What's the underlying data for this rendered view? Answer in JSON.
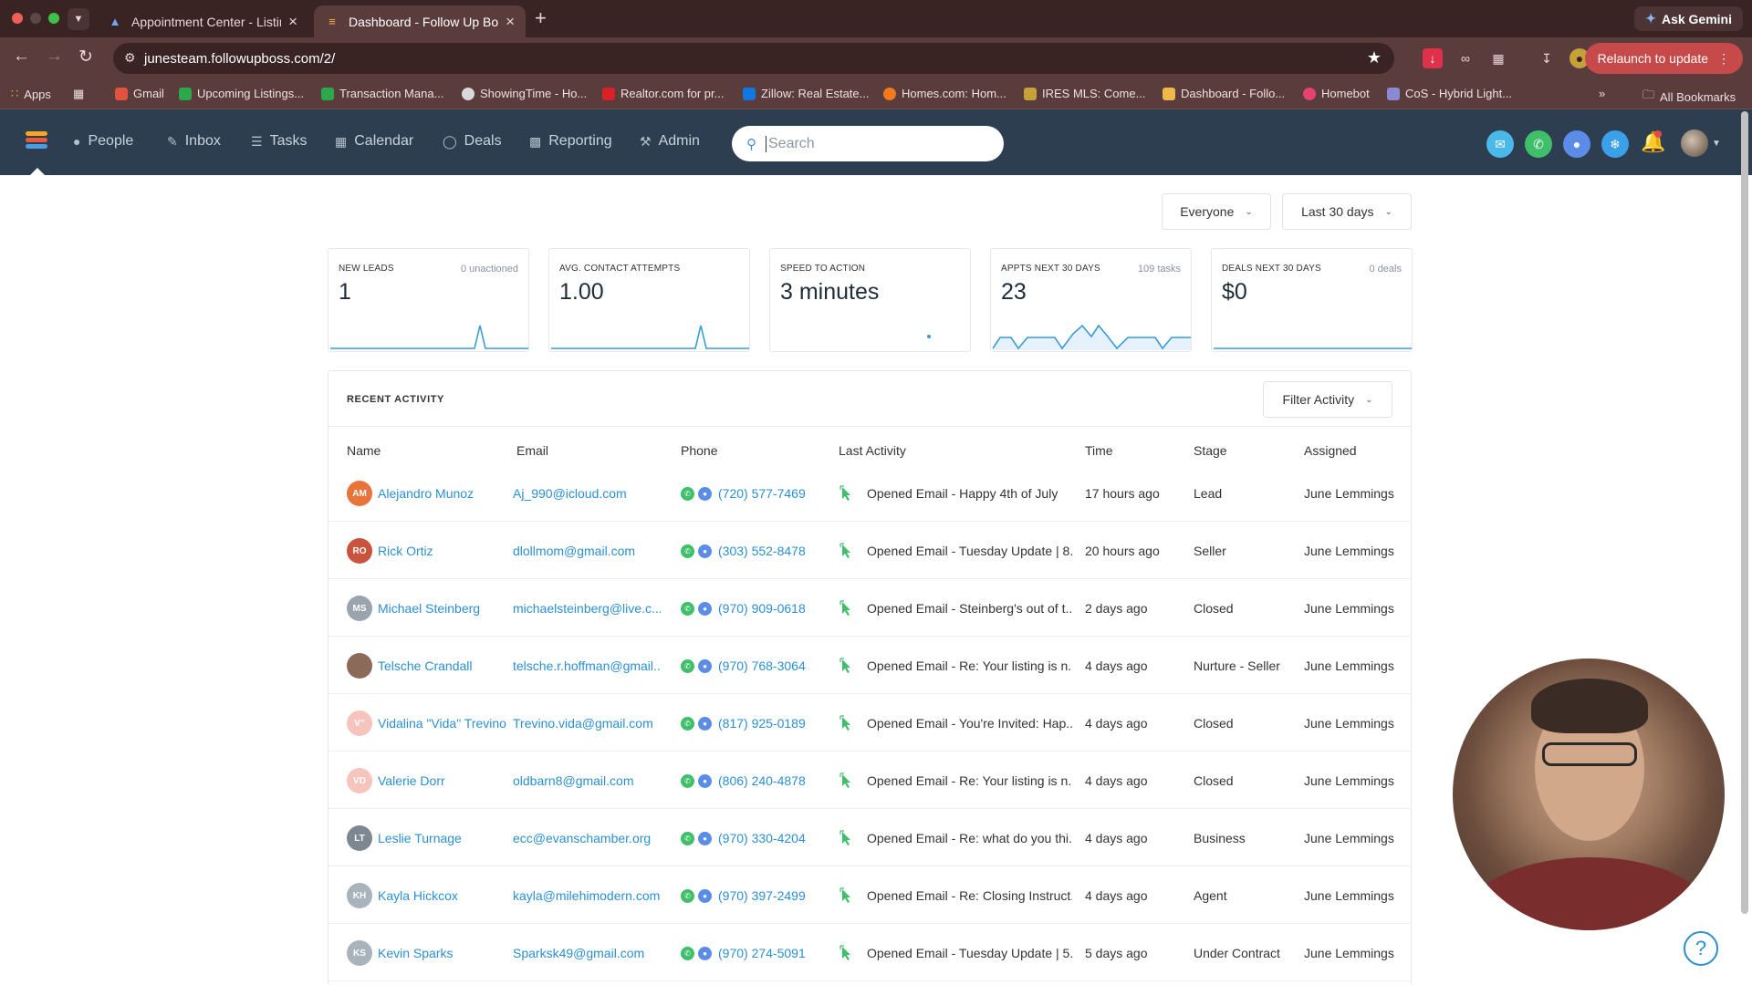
{
  "browser": {
    "tabs": [
      {
        "title": "Appointment Center - Listing",
        "active": false
      },
      {
        "title": "Dashboard - Follow Up Boss",
        "active": true
      }
    ],
    "url": "junesteam.followupboss.com/2/",
    "ask_gemini": "Ask Gemini",
    "relaunch": "Relaunch to update",
    "bookmarks": [
      "Apps",
      "Gmail",
      "Upcoming Listings...",
      "Transaction Mana...",
      "ShowingTime - Ho...",
      "Realtor.com for pr...",
      "Zillow: Real Estate...",
      "Homes.com: Hom...",
      "IRES MLS: Come...",
      "Dashboard - Follo...",
      "Homebot",
      "CoS - Hybrid Light..."
    ],
    "all_bookmarks": "All Bookmarks"
  },
  "nav": {
    "items": [
      "People",
      "Inbox",
      "Tasks",
      "Calendar",
      "Deals",
      "Reporting",
      "Admin"
    ],
    "search_placeholder": "Search"
  },
  "filters": {
    "who": "Everyone",
    "range": "Last 30 days"
  },
  "cards": [
    {
      "label": "NEW LEADS",
      "meta": "0 unactioned",
      "value": "1"
    },
    {
      "label": "AVG. CONTACT ATTEMPTS",
      "meta": "",
      "value": "1.00"
    },
    {
      "label": "SPEED TO ACTION",
      "meta": "",
      "value": "3 minutes"
    },
    {
      "label": "APPTS NEXT 30 DAYS",
      "meta": "109 tasks",
      "value": "23"
    },
    {
      "label": "DEALS NEXT 30 DAYS",
      "meta": "0 deals",
      "value": "$0"
    }
  ],
  "activity": {
    "title": "RECENT ACTIVITY",
    "filter_label": "Filter Activity",
    "columns": [
      "Name",
      "Email",
      "Phone",
      "Last Activity",
      "Time",
      "Stage",
      "Assigned"
    ],
    "rows": [
      {
        "initials": "AM",
        "color": "#e8743b",
        "name": "Alejandro Munoz",
        "email": "Aj_990@icloud.com",
        "phone": "(720) 577-7469",
        "activity": "Opened Email - Happy 4th of July",
        "time": "17 hours ago",
        "stage": "Lead",
        "assigned": "June Lemmings"
      },
      {
        "initials": "RO",
        "color": "#c9533d",
        "name": "Rick Ortiz",
        "email": "dlollmom@gmail.com",
        "phone": "(303) 552-8478",
        "activity": "Opened Email - Tuesday Update | 8...",
        "time": "20 hours ago",
        "stage": "Seller",
        "assigned": "June Lemmings"
      },
      {
        "initials": "MS",
        "color": "#9aa4ae",
        "name": "Michael Steinberg",
        "email": "michaelsteinberg@live.c...",
        "phone": "(970) 909-0618",
        "activity": "Opened Email - Steinberg's out of t...",
        "time": "2 days ago",
        "stage": "Closed",
        "assigned": "June Lemmings"
      },
      {
        "initials": "",
        "color": "#8b6a5a",
        "name": "Telsche Crandall",
        "email": "telsche.r.hoffman@gmail....",
        "phone": "(970) 768-3064",
        "activity": "Opened Email - Re: Your listing is n...",
        "time": "4 days ago",
        "stage": "Nurture - Seller",
        "assigned": "June Lemmings"
      },
      {
        "initials": "V\"",
        "color": "#f6c4bd",
        "name": "Vidalina \"Vida\" Trevino",
        "email": "Trevino.vida@gmail.com",
        "phone": "(817) 925-0189",
        "activity": "Opened Email - You're Invited: Hap...",
        "time": "4 days ago",
        "stage": "Closed",
        "assigned": "June Lemmings"
      },
      {
        "initials": "VD",
        "color": "#f6c4bd",
        "name": "Valerie Dorr",
        "email": "oldbarn8@gmail.com",
        "phone": "(806) 240-4878",
        "activity": "Opened Email - Re: Your listing is n...",
        "time": "4 days ago",
        "stage": "Closed",
        "assigned": "June Lemmings"
      },
      {
        "initials": "LT",
        "color": "#7d8791",
        "name": "Leslie Turnage",
        "email": "ecc@evanschamber.org",
        "phone": "(970) 330-4204",
        "activity": "Opened Email - Re: what do you thi...",
        "time": "4 days ago",
        "stage": "Business",
        "assigned": "June Lemmings"
      },
      {
        "initials": "KH",
        "color": "#a9b3bc",
        "name": "Kayla Hickcox",
        "email": "kayla@milehimodern.com",
        "phone": "(970) 397-2499",
        "activity": "Opened Email - Re: Closing Instruct...",
        "time": "4 days ago",
        "stage": "Agent",
        "assigned": "June Lemmings"
      },
      {
        "initials": "KS",
        "color": "#a9b3bc",
        "name": "Kevin Sparks",
        "email": "Sparksk49@gmail.com",
        "phone": "(970) 274-5091",
        "activity": "Opened Email - Tuesday Update | 5...",
        "time": "5 days ago",
        "stage": "Under Contract",
        "assigned": "June Lemmings"
      }
    ]
  }
}
